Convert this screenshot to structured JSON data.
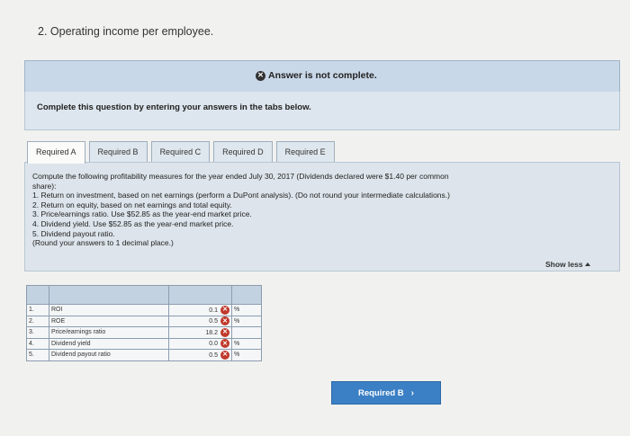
{
  "question": {
    "title": "2. Operating income per employee."
  },
  "banner": {
    "status_text": "Answer is not complete."
  },
  "instruction": {
    "text": "Complete this question by entering your answers in the tabs below."
  },
  "tabs": [
    {
      "label": "Required A",
      "active": true
    },
    {
      "label": "Required B",
      "active": false
    },
    {
      "label": "Required C",
      "active": false
    },
    {
      "label": "Required D",
      "active": false
    },
    {
      "label": "Required E",
      "active": false
    }
  ],
  "problem": {
    "lines": [
      "Compute the following profitability measures for the year ended July 30, 2017 (Dividends declared were $1.40 per common",
      "share):",
      "1. Return on investment, based on net earnings (perform a DuPont analysis). (Do not round your intermediate calculations.)",
      "2. Return on equity, based on net earnings and total equity.",
      "3. Price/earnings ratio. Use $52.85 as the year-end market price.",
      "4. Dividend yield. Use $52.85 as the year-end market price.",
      "5. Dividend payout ratio.",
      "(Round your answers to 1 decimal place.)"
    ],
    "show_less": "Show less"
  },
  "answers": [
    {
      "num": "1.",
      "label": "ROI",
      "value": "0.1",
      "unit": "%"
    },
    {
      "num": "2.",
      "label": "ROE",
      "value": "0.5",
      "unit": "%"
    },
    {
      "num": "3.",
      "label": "Price/earnings ratio",
      "value": "18.2",
      "unit": ""
    },
    {
      "num": "4.",
      "label": "Dividend yield",
      "value": "0.0",
      "unit": "%"
    },
    {
      "num": "5.",
      "label": "Dividend payout ratio",
      "value": "0.5",
      "unit": "%"
    }
  ],
  "nav": {
    "next_label": "Required B"
  },
  "colors": {
    "accent": "#3b7fc4",
    "error": "#c0392b",
    "banner": "#c9d8e8"
  }
}
